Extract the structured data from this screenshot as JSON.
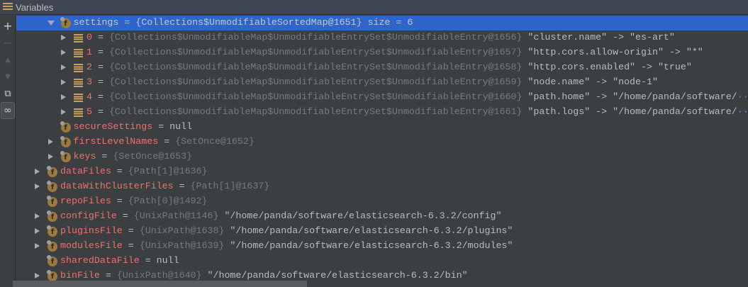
{
  "panel": {
    "title": "Variables"
  },
  "toolbar": {
    "add": "+",
    "remove": "−",
    "up": "▲",
    "down": "▼",
    "copy": "⧉",
    "watch": "∞"
  },
  "rows": [
    {
      "level": 1,
      "arrow": "down",
      "icon": "field",
      "name": "settings",
      "type": "{Collections$UnmodifiableSortedMap@1651}",
      "value": "  size = 6",
      "selected": true
    },
    {
      "level": 2,
      "arrow": "right",
      "icon": "list",
      "name": "0",
      "type": "{Collections$UnmodifiableMap$UnmodifiableEntrySet$UnmodifiableEntry@1656}",
      "value": "\"cluster.name\" -> \"es-art\""
    },
    {
      "level": 2,
      "arrow": "right",
      "icon": "list",
      "name": "1",
      "type": "{Collections$UnmodifiableMap$UnmodifiableEntrySet$UnmodifiableEntry@1657}",
      "value": "\"http.cors.allow-origin\" -> \"*\""
    },
    {
      "level": 2,
      "arrow": "right",
      "icon": "list",
      "name": "2",
      "type": "{Collections$UnmodifiableMap$UnmodifiableEntrySet$UnmodifiableEntry@1658}",
      "value": "\"http.cors.enabled\" -> \"true\""
    },
    {
      "level": 2,
      "arrow": "right",
      "icon": "list",
      "name": "3",
      "type": "{Collections$UnmodifiableMap$UnmodifiableEntrySet$UnmodifiableEntry@1659}",
      "value": "\"node.name\" -> \"node-1\""
    },
    {
      "level": 2,
      "arrow": "right",
      "icon": "list",
      "name": "4",
      "type": "{Collections$UnmodifiableMap$UnmodifiableEntrySet$UnmodifiableEntry@1660}",
      "value": "\"path.home\" -> \"/home/panda/software/",
      "more": "···"
    },
    {
      "level": 2,
      "arrow": "right",
      "icon": "list",
      "name": "5",
      "type": "{Collections$UnmodifiableMap$UnmodifiableEntrySet$UnmodifiableEntry@1661}",
      "value": "\"path.logs\" -> \"/home/panda/software/",
      "more": "···"
    },
    {
      "level": 1,
      "arrow": "none",
      "icon": "field",
      "name": "secureSettings",
      "type": "",
      "value": "null"
    },
    {
      "level": 1,
      "arrow": "right",
      "icon": "field",
      "name": "firstLevelNames",
      "type": "{SetOnce@1652}",
      "value": ""
    },
    {
      "level": 1,
      "arrow": "right",
      "icon": "field",
      "name": "keys",
      "type": "{SetOnce@1653}",
      "value": ""
    },
    {
      "level": 0,
      "arrow": "right",
      "icon": "field",
      "name": "dataFiles",
      "type": "{Path[1]@1636}",
      "value": ""
    },
    {
      "level": 0,
      "arrow": "right",
      "icon": "field",
      "name": "dataWithClusterFiles",
      "type": "{Path[1]@1637}",
      "value": ""
    },
    {
      "level": 0,
      "arrow": "none",
      "icon": "field",
      "name": "repoFiles",
      "type": "{Path[0]@1492}",
      "value": ""
    },
    {
      "level": 0,
      "arrow": "right",
      "icon": "field",
      "name": "configFile",
      "type": "{UnixPath@1146}",
      "value": "\"/home/panda/software/elasticsearch-6.3.2/config\""
    },
    {
      "level": 0,
      "arrow": "right",
      "icon": "field",
      "name": "pluginsFile",
      "type": "{UnixPath@1638}",
      "value": "\"/home/panda/software/elasticsearch-6.3.2/plugins\""
    },
    {
      "level": 0,
      "arrow": "right",
      "icon": "field",
      "name": "modulesFile",
      "type": "{UnixPath@1639}",
      "value": "\"/home/panda/software/elasticsearch-6.3.2/modules\""
    },
    {
      "level": 0,
      "arrow": "none",
      "icon": "field",
      "name": "sharedDataFile",
      "type": "",
      "value": "null"
    },
    {
      "level": 0,
      "arrow": "right",
      "icon": "field",
      "name": "binFile",
      "type": "{UnixPath@1640}",
      "value": "\"/home/panda/software/elasticsearch-6.3.2/bin\""
    }
  ]
}
